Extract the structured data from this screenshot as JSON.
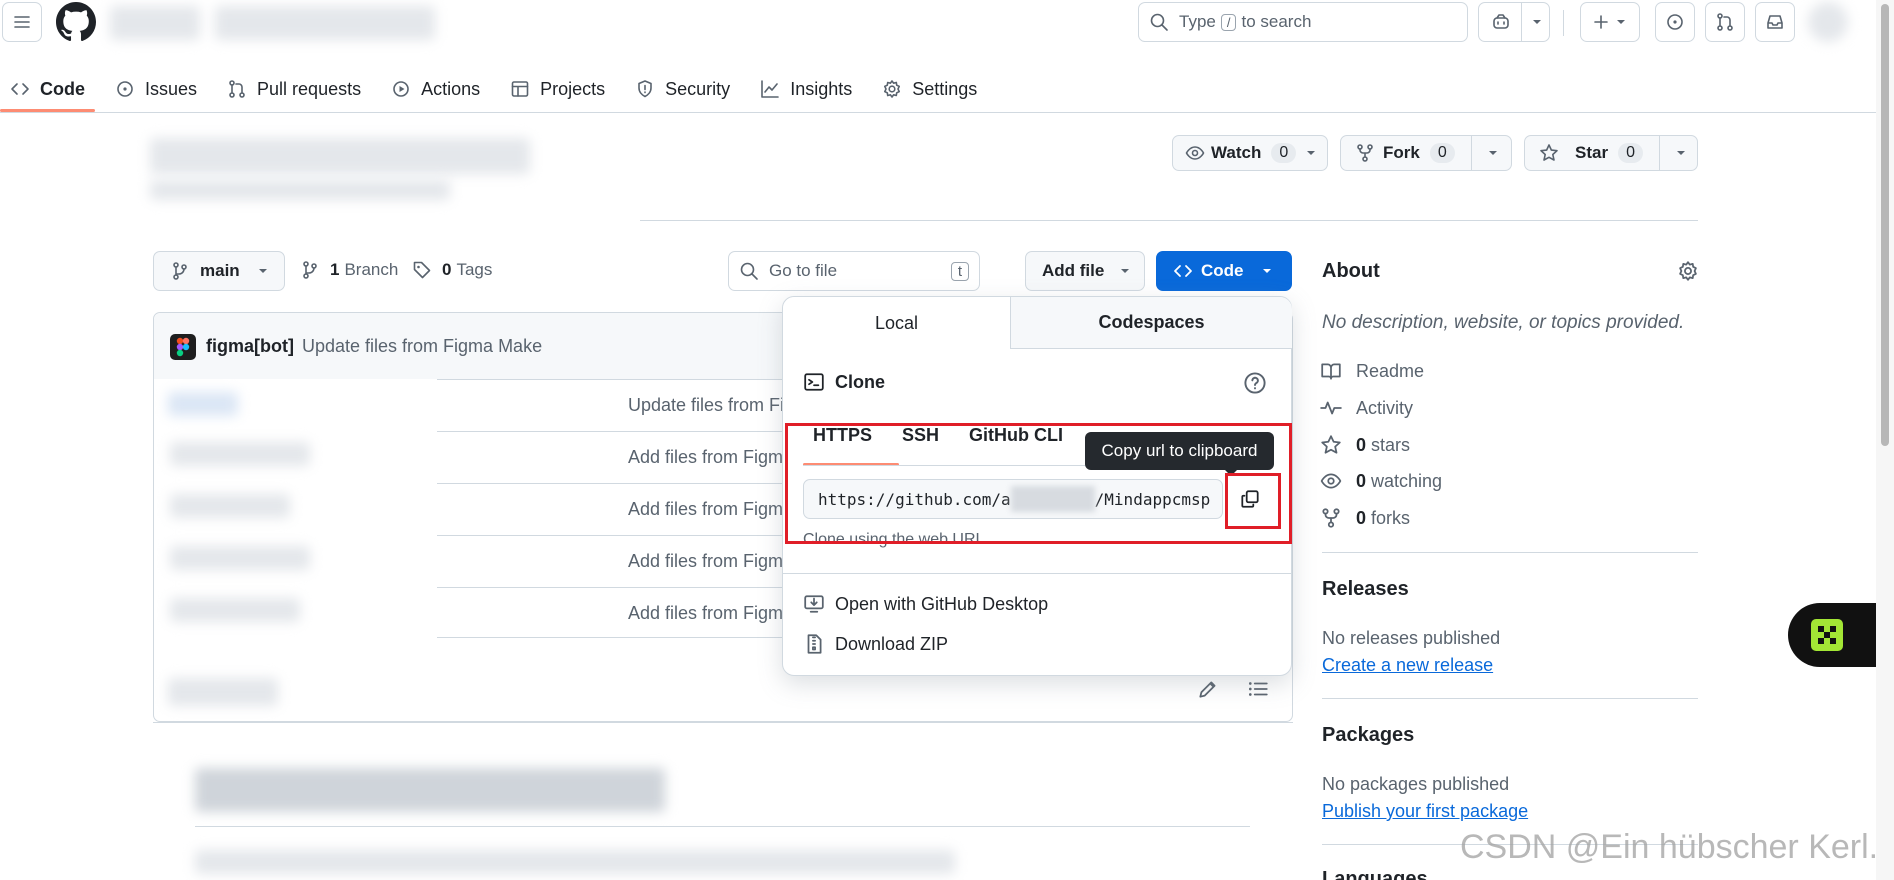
{
  "header": {
    "search_placeholder_pre": "Type",
    "search_key": "/",
    "search_placeholder_post": "to search"
  },
  "nav": {
    "tabs": [
      {
        "label": "Code",
        "icon": "code-icon"
      },
      {
        "label": "Issues",
        "icon": "issue-icon"
      },
      {
        "label": "Pull requests",
        "icon": "pull-request-icon"
      },
      {
        "label": "Actions",
        "icon": "play-icon"
      },
      {
        "label": "Projects",
        "icon": "table-icon"
      },
      {
        "label": "Security",
        "icon": "shield-icon"
      },
      {
        "label": "Insights",
        "icon": "graph-icon"
      },
      {
        "label": "Settings",
        "icon": "gear-icon"
      }
    ]
  },
  "repo_actions": {
    "watch_label": "Watch",
    "watch_count": "0",
    "fork_label": "Fork",
    "fork_count": "0",
    "star_label": "Star",
    "star_count": "0"
  },
  "toolbar": {
    "branch": "main",
    "branches_count": "1",
    "branches_label": "Branch",
    "tags_count": "0",
    "tags_label": "Tags",
    "goto_placeholder": "Go to file",
    "goto_key": "t",
    "add_file_label": "Add file",
    "code_label": "Code"
  },
  "commit": {
    "author": "figma[bot]",
    "message": "Update files from Figma Make"
  },
  "files": [
    {
      "message": "Update files from Fi"
    },
    {
      "message": "Add files from Figm"
    },
    {
      "message": "Add files from Figm"
    },
    {
      "message": "Add files from Figm"
    },
    {
      "message": "Add files from Figm"
    }
  ],
  "clone_popup": {
    "tab_local": "Local",
    "tab_codespaces": "Codespaces",
    "clone_title": "Clone",
    "protocols": [
      "HTTPS",
      "SSH",
      "GitHub CLI"
    ],
    "url_prefix": "https://github.com/a",
    "url_suffix": "/Mindappcmsp",
    "hint": "Clone using the web URL.",
    "tooltip": "Copy url to clipboard",
    "open_desktop": "Open with GitHub Desktop",
    "download_zip": "Download ZIP"
  },
  "about": {
    "title": "About",
    "description": "No description, website, or topics provided.",
    "links": [
      {
        "label": "Readme",
        "count": "",
        "icon": "book-icon"
      },
      {
        "label": "Activity",
        "count": "",
        "icon": "pulse-icon"
      },
      {
        "label": "stars",
        "count": "0",
        "icon": "star-icon"
      },
      {
        "label": "watching",
        "count": "0",
        "icon": "eye-icon"
      },
      {
        "label": "forks",
        "count": "0",
        "icon": "fork-icon"
      }
    ]
  },
  "releases": {
    "title": "Releases",
    "empty": "No releases published",
    "link": "Create a new release"
  },
  "packages": {
    "title": "Packages",
    "empty": "No packages published",
    "link": "Publish your first package"
  },
  "languages": {
    "title": "Languages"
  },
  "watermark": "CSDN @Ein hübscher Kerl.",
  "colors": {
    "primary_blue": "#0969da",
    "link_blue": "#0969da",
    "active_tab_underline": "#fd8c73",
    "highlight_red": "#e01e28",
    "tooltip_bg": "#25292e",
    "fab_green": "#a3e635"
  }
}
